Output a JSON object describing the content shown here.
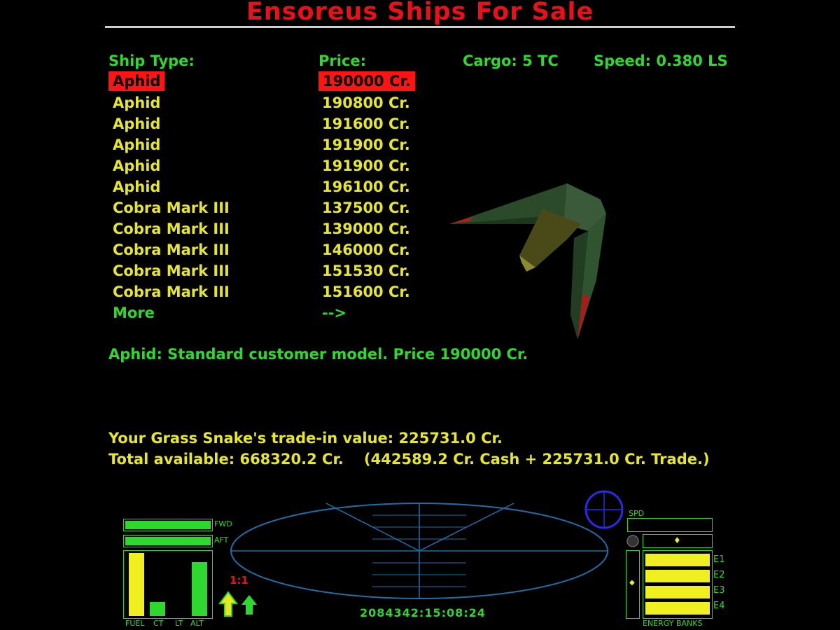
{
  "title": "Ensoreus Ships For Sale",
  "headers": {
    "ship_type": "Ship Type:",
    "price": "Price:",
    "cargo": "Cargo: 5 TC",
    "speed": "Speed: 0.380 LS"
  },
  "ships": [
    {
      "name": "Aphid",
      "price": "190000 Cr."
    },
    {
      "name": "Aphid",
      "price": "190800 Cr."
    },
    {
      "name": "Aphid",
      "price": "191600 Cr."
    },
    {
      "name": "Aphid",
      "price": "191900 Cr."
    },
    {
      "name": "Aphid",
      "price": "191900 Cr."
    },
    {
      "name": "Aphid",
      "price": "196100 Cr."
    },
    {
      "name": "Cobra Mark III",
      "price": "137500 Cr."
    },
    {
      "name": "Cobra Mark III",
      "price": "139000 Cr."
    },
    {
      "name": "Cobra Mark III",
      "price": "146000 Cr."
    },
    {
      "name": "Cobra Mark III",
      "price": "151530 Cr."
    },
    {
      "name": "Cobra Mark III",
      "price": "151600 Cr."
    }
  ],
  "more": {
    "label": "More",
    "arrow": "-->"
  },
  "description": "Aphid: Standard customer model. Price 190000 Cr.",
  "trade_in": "Your Grass Snake's trade-in value: 225731.0 Cr.",
  "total_available": "Total available: 668320.2 Cr.    (442589.2 Cr. Cash + 225731.0 Cr. Trade.)",
  "hud": {
    "fwd": "FWD",
    "aft": "AFT",
    "bottom_labels": [
      "FUEL",
      "CT",
      "LT",
      "ALT"
    ],
    "zoom": "1:1",
    "spd": "SPD",
    "energy_banks": "ENERGY BANKS",
    "energy_labels": [
      "E1",
      "E2",
      "E3",
      "E4"
    ],
    "clock": "2084342:15:08:24",
    "levels": {
      "fwd": 1.0,
      "aft": 1.0,
      "fuel": 1.0,
      "ct": 0.22,
      "lt": 0.0,
      "alt": 0.85
    },
    "colors": {
      "green": "#2ed82e",
      "yellow": "#f0f020",
      "red": "#e8101a",
      "scanner": "#1e6fa8"
    }
  }
}
